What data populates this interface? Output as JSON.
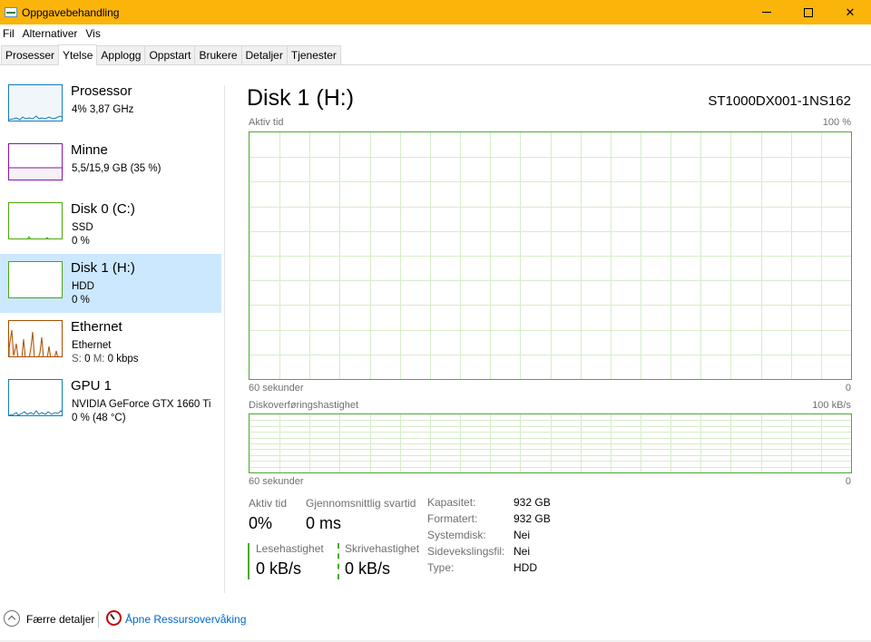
{
  "window": {
    "title": "Oppgavebehandling"
  },
  "menu": [
    "Fil",
    "Alternativer",
    "Vis"
  ],
  "tabs": [
    "Prosesser",
    "Ytelse",
    "Applogg",
    "Oppstart",
    "Brukere",
    "Detaljer",
    "Tjenester"
  ],
  "active_tab": "Ytelse",
  "sidebar": {
    "items": [
      {
        "name": "Prosessor",
        "sub1": "4% 3,87 GHz",
        "sub2": "",
        "color": "#117dbb"
      },
      {
        "name": "Minne",
        "sub1": "5,5/15,9 GB (35 %)",
        "sub2": "",
        "color": "#8b12ae"
      },
      {
        "name": "Disk 0 (C:)",
        "sub1": "SSD",
        "sub2": "0 %",
        "color": "#4da60c"
      },
      {
        "name": "Disk 1 (H:)",
        "sub1": "HDD",
        "sub2": "0 %",
        "color": "#4da60c"
      },
      {
        "name": "Ethernet",
        "sub1": "Ethernet",
        "sub2_s": "S:",
        "sub2_s_val": "0",
        "sub2_m": "M:",
        "sub2_m_val": "0 kbps",
        "color": "#a74f01"
      },
      {
        "name": "GPU 1",
        "sub1": "NVIDIA GeForce GTX 1660 Ti",
        "sub2": "0 % (48 °C)",
        "color": "#117dbb"
      }
    ],
    "selected": "Disk 1 (H:)"
  },
  "main": {
    "title": "Disk 1 (H:)",
    "model": "ST1000DX001-1NS162",
    "graph1": {
      "label": "Aktiv tid",
      "max": "100 %",
      "time": "60 sekunder",
      "min": "0"
    },
    "graph2": {
      "label": "Diskoverføringshastighet",
      "max": "100 kB/s",
      "time": "60 sekunder",
      "min": "0"
    },
    "stats": {
      "active_time_label": "Aktiv tid",
      "active_time_value": "0%",
      "avg_response_label": "Gjennomsnittlig svartid",
      "avg_response_value": "0 ms",
      "read_label": "Lesehastighet",
      "read_value": "0 kB/s",
      "write_label": "Skrivehastighet",
      "write_value": "0 kB/s"
    },
    "properties": [
      {
        "key": "Kapasitet:",
        "value": "932 GB"
      },
      {
        "key": "Formatert:",
        "value": "932 GB"
      },
      {
        "key": "Systemdisk:",
        "value": "Nei"
      },
      {
        "key": "Sidevekslingsfil:",
        "value": "Nei"
      },
      {
        "key": "Type:",
        "value": "HDD"
      }
    ]
  },
  "footer": {
    "fewer_details": "Færre detaljer",
    "resource_monitor": "Åpne Ressursovervåking"
  }
}
